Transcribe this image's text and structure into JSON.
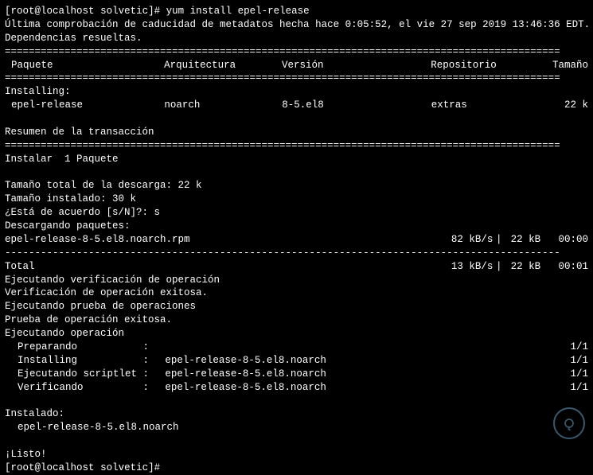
{
  "prompt1": {
    "user": "root",
    "host": "localhost",
    "cwd": "solvetic",
    "cmd": "yum install epel-release"
  },
  "meta_line": "Última comprobación de caducidad de metadatos hecha hace 0:05:52, el vie 27 sep 2019 13:46:36 EDT.",
  "deps": "Dependencias resueltas.",
  "divider": "=============================================================================================",
  "headers": {
    "pkg": "Paquete",
    "arch": "Arquitectura",
    "ver": "Versión",
    "repo": "Repositorio",
    "size": "Tamaño"
  },
  "installing": "Installing:",
  "row": {
    "pkg": "epel-release",
    "arch": "noarch",
    "ver": "8-5.el8",
    "repo": "extras",
    "size": "22 k"
  },
  "summary_title": "Resumen de la transacción",
  "install_count": "Instalar  1 Paquete",
  "total_dl": "Tamaño total de la descarga: 22 k",
  "installed_size": "Tamaño instalado: 30 k",
  "confirm": "¿Está de acuerdo [s/N]?: s",
  "downloading": "Descargando paquetes:",
  "dl_row": {
    "name": "epel-release-8-5.el8.noarch.rpm",
    "speed": "82 kB/s",
    "sep": "|",
    "size": "22 kB",
    "time": "00:00"
  },
  "dashline": "---------------------------------------------------------------------------------------------",
  "total_row": {
    "name": "Total",
    "speed": "13 kB/s",
    "sep": "|",
    "size": "22 kB",
    "time": "00:01"
  },
  "verify1": "Ejecutando verificación de operación",
  "verify2": "Verificación de operación exitosa.",
  "test1": "Ejecutando prueba de operaciones",
  "test2": "Prueba de operación exitosa.",
  "run_op": "Ejecutando operación",
  "ops": [
    {
      "label": "Preparando",
      "sep": ":",
      "pkg": "",
      "prog": "1/1"
    },
    {
      "label": "Installing",
      "sep": ":",
      "pkg": "epel-release-8-5.el8.noarch",
      "prog": "1/1"
    },
    {
      "label": "Ejecutando scriptlet",
      "sep": ":",
      "pkg": "epel-release-8-5.el8.noarch",
      "prog": "1/1"
    },
    {
      "label": "Verificando",
      "sep": ":",
      "pkg": "epel-release-8-5.el8.noarch",
      "prog": "1/1"
    }
  ],
  "installed_header": "Instalado:",
  "installed_pkg": "epel-release-8-5.el8.noarch",
  "done": "¡Listo!",
  "prompt2": {
    "user": "root",
    "host": "localhost",
    "cwd": "solvetic"
  }
}
